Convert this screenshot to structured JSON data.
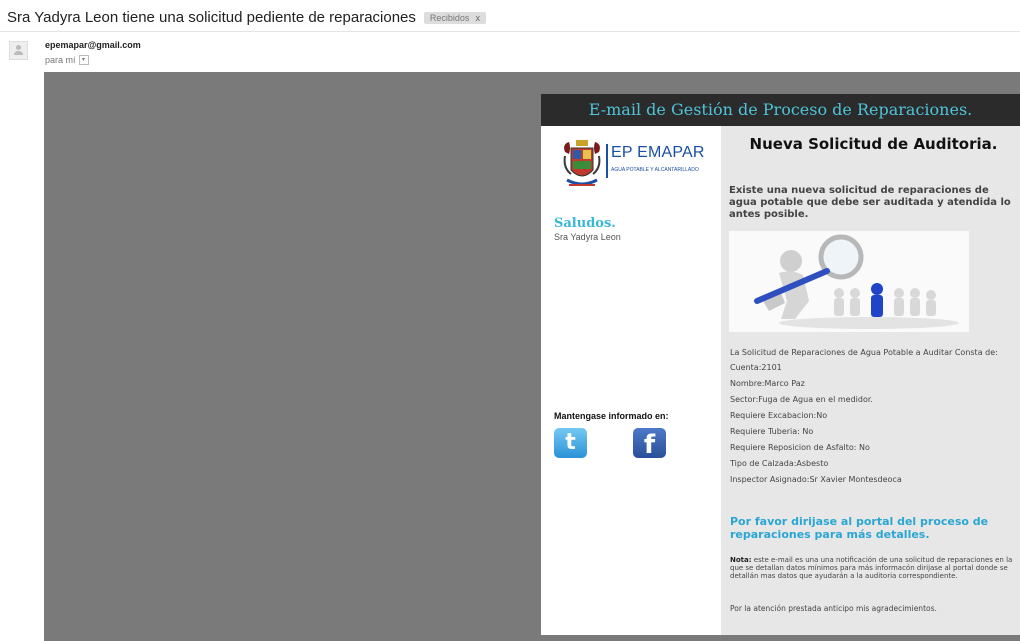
{
  "email": {
    "subject": "Sra Yadyra Leon tiene una solicitud pediente de reparaciones",
    "label": "Recibidos",
    "label_close": "x",
    "sender": "epemapar@gmail.com",
    "recipient": "para mí",
    "recipient_dropdown": "▾"
  },
  "banner": {
    "title": "E-mail de Gestión de Proceso de Reparaciones."
  },
  "logo": {
    "brand": "EP EMAPAR",
    "tagline": "AGUA POTABLE Y ALCANTARILLADO"
  },
  "greeting": {
    "title": "Saludos.",
    "name": "Sra Yadyra Leon"
  },
  "social": {
    "heading": "Mantengase informado en:",
    "twitter_glyph": "t",
    "facebook_glyph": "f"
  },
  "content": {
    "title": "Nueva Solicitud de Auditoria.",
    "intro": "Existe una nueva solicitud de reparaciones de agua potable que debe ser auditada y atendida lo antes posible.",
    "details_intro": "La Solicitud de Reparaciones de Agua Potable a Auditar Consta de:",
    "details": [
      "Cuenta:2101",
      "Nombre:Marco Paz",
      "Sector:Fuga de Agua en el medidor.",
      "Requiere Excabacion:No",
      "Requiere Tuberia: No",
      "Requiere Reposicion de Asfalto: No",
      "Tipo de Calzada:Asbesto",
      "Inspector Asignado:Sr Xavier Montesdeoca"
    ],
    "cta": "Por favor dirijase al portal del proceso de reparaciones para más detalles.",
    "note_label": "Nota:",
    "note_text": " este e-mail es una una notificación de una solicitud de reparaciones en la que se detallan datos mínimos para más informacón dirijase al portal donde se detallán mas datos que ayudarán a la auditoria correspondiente.",
    "thanks": "Por la atención prestada anticipo mis agradecimientos."
  },
  "colors": {
    "accent": "#4fc3d8",
    "cta": "#2aa6d3",
    "banner_bg": "#2b2b2b",
    "backdrop": "#7a7a7a",
    "brand_blue": "#1a4fa3"
  }
}
